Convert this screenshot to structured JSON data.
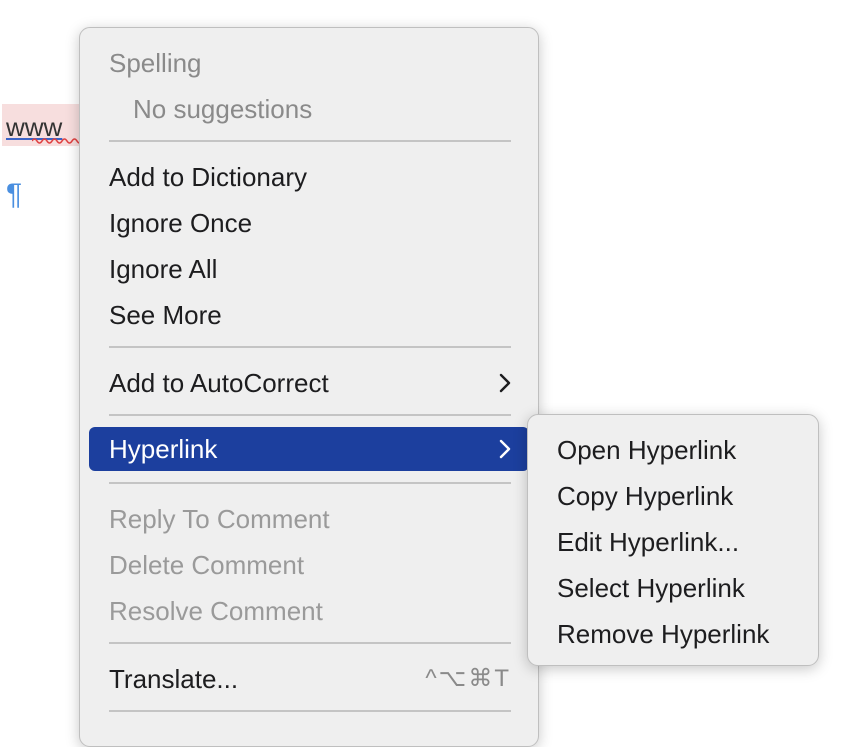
{
  "document": {
    "misspelled_word": "www",
    "pilcrow": "¶"
  },
  "menu": {
    "spelling_heading": "Spelling",
    "no_suggestions": "No suggestions",
    "add_to_dictionary": "Add to Dictionary",
    "ignore_once": "Ignore Once",
    "ignore_all": "Ignore All",
    "see_more": "See More",
    "add_to_autocorrect": "Add to AutoCorrect",
    "hyperlink": "Hyperlink",
    "reply_to_comment": "Reply To Comment",
    "delete_comment": "Delete Comment",
    "resolve_comment": "Resolve Comment",
    "translate": "Translate...",
    "translate_shortcut": "^⌥⌘T"
  },
  "submenu": {
    "open_hyperlink": "Open Hyperlink",
    "copy_hyperlink": "Copy Hyperlink",
    "edit_hyperlink": "Edit Hyperlink...",
    "select_hyperlink": "Select Hyperlink",
    "remove_hyperlink": "Remove Hyperlink"
  },
  "icons": {
    "submenu_arrow": "chevron-right-icon"
  },
  "colors": {
    "highlight": "#1c3f9e",
    "menu_background": "#efefef",
    "disabled_text": "#9a9a9a",
    "misspelling_squiggle": "#e04040",
    "pilcrow": "#4a8fe0"
  }
}
